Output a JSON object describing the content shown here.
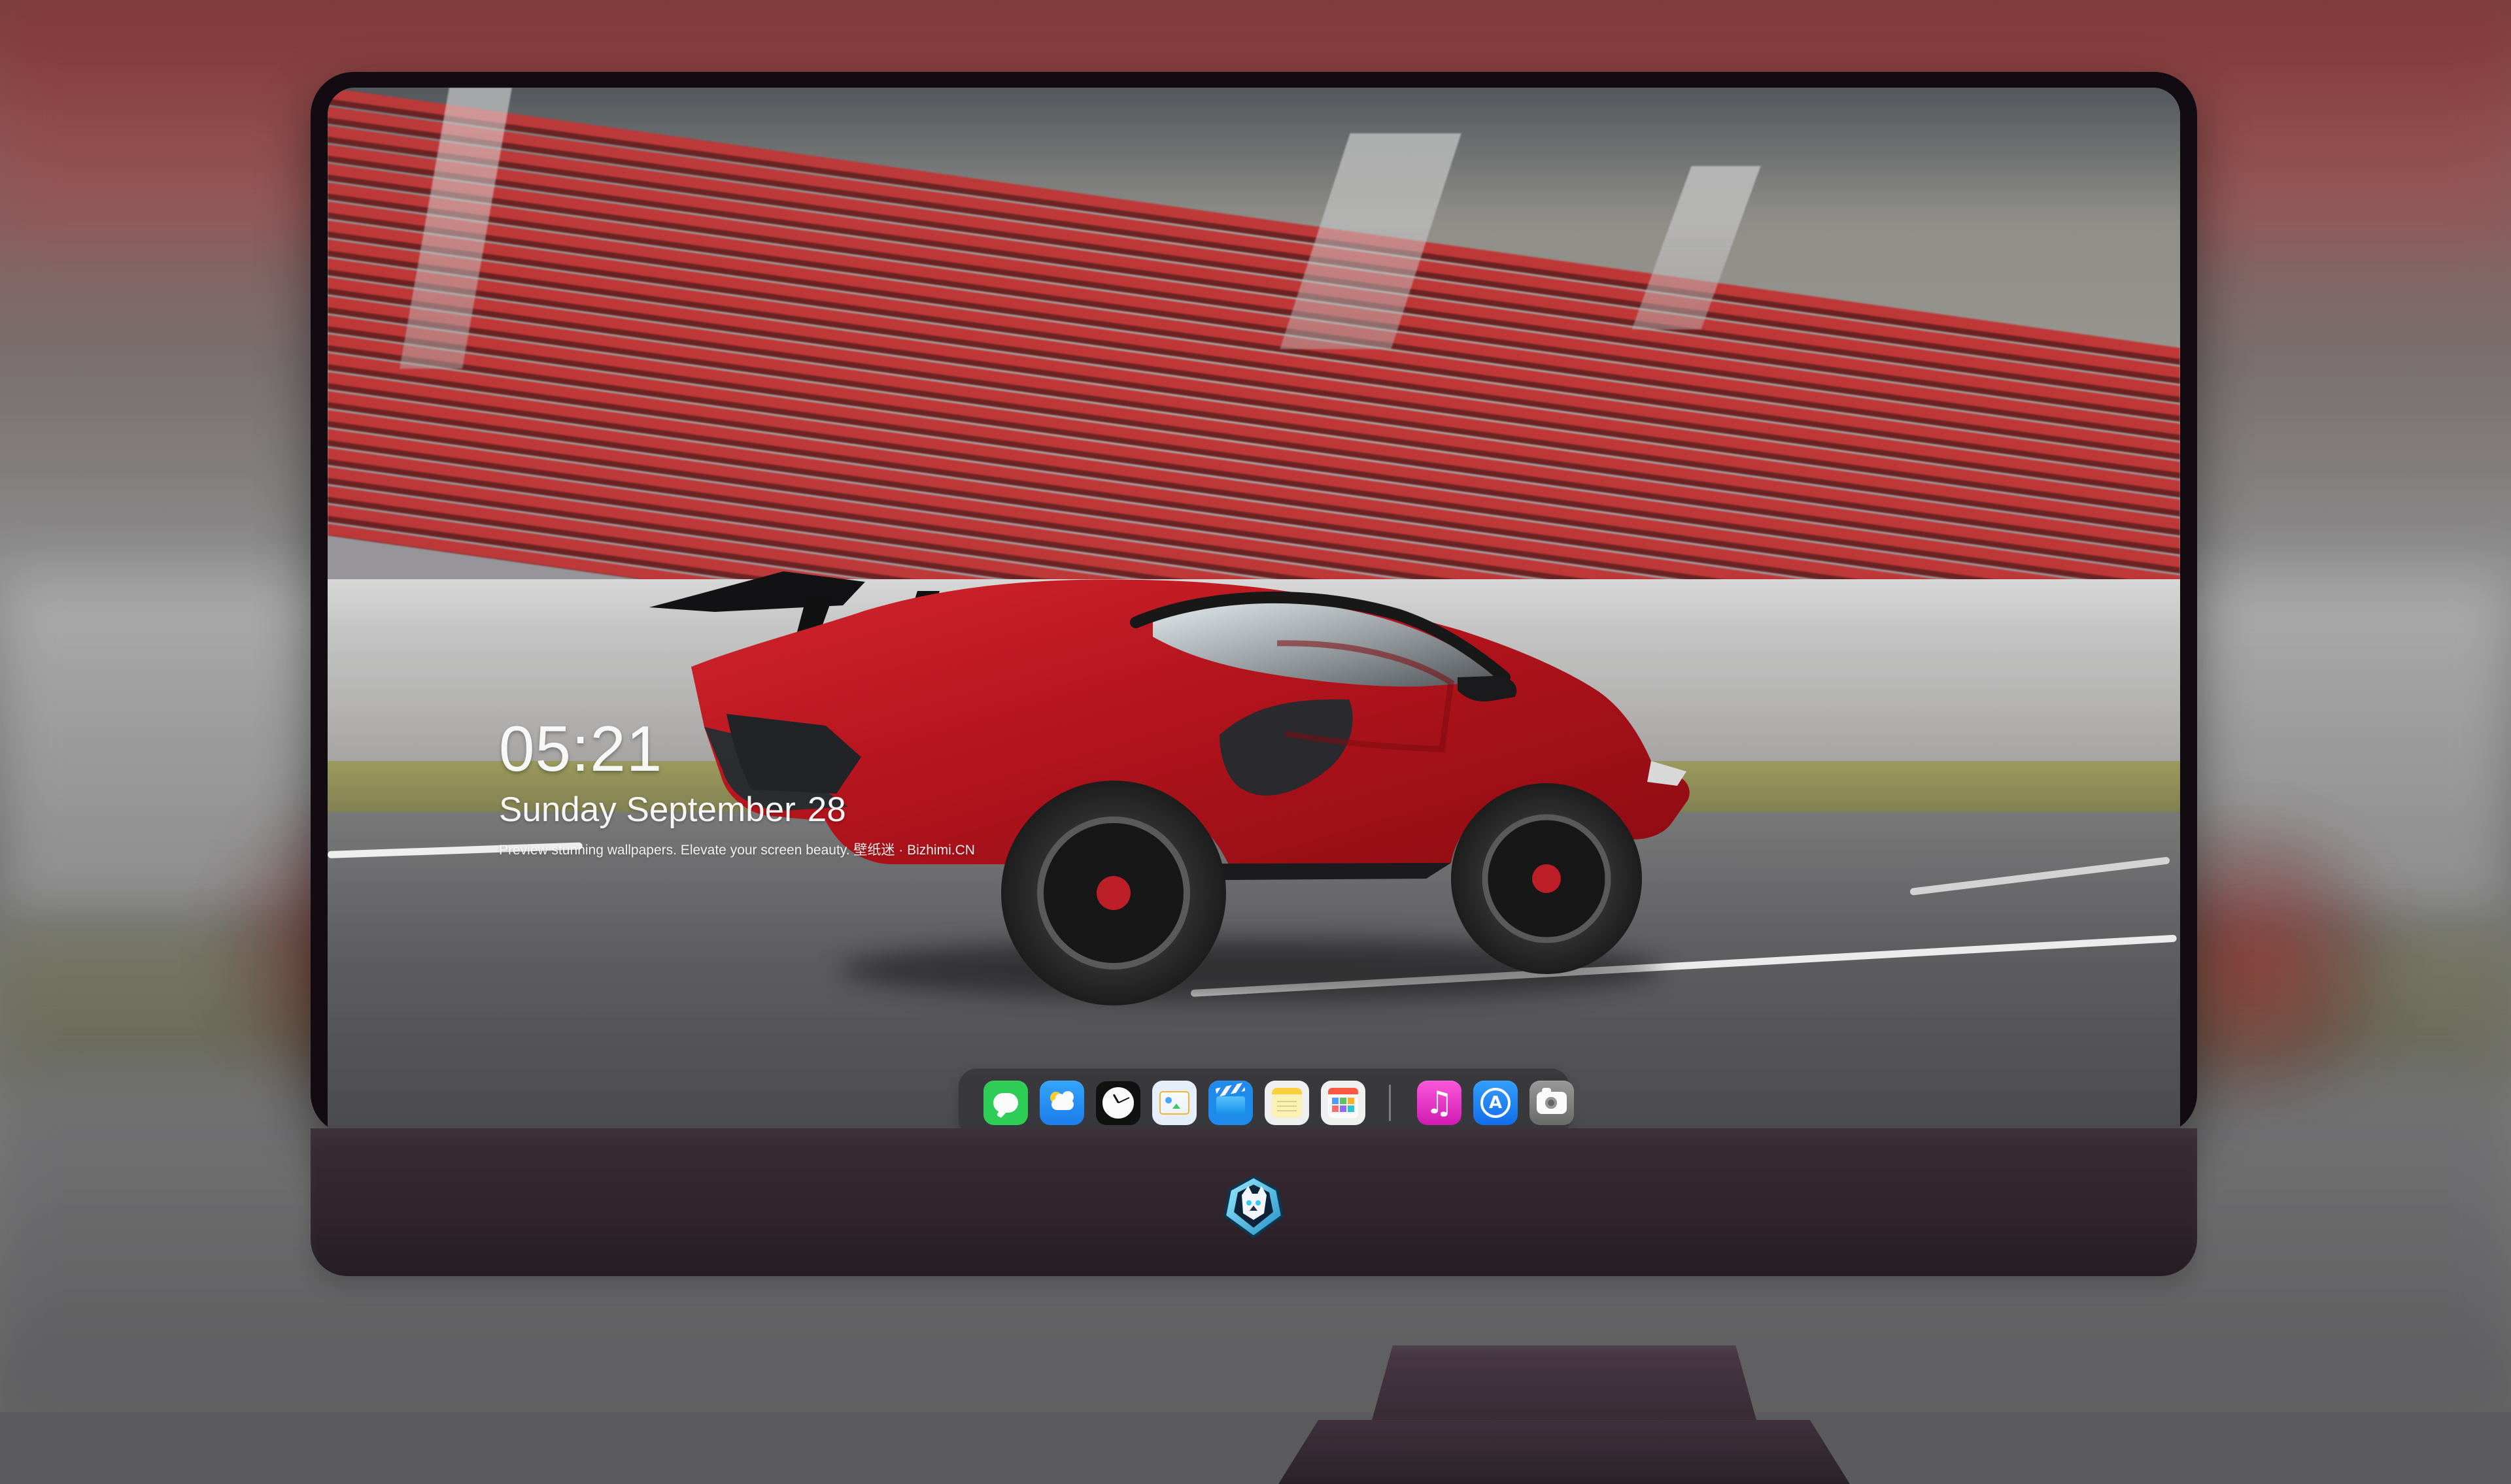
{
  "lock_screen": {
    "time": "05:21",
    "date_weekday_month": "Sunday September",
    "date_day": "28",
    "subtitle": "Preview stunning wallpapers. Elevate your screen beauty. 壁纸迷 · Bizhimi.CN"
  },
  "dock": {
    "left_icons": [
      {
        "name": "messages-icon"
      },
      {
        "name": "weather-icon"
      },
      {
        "name": "clock-icon"
      },
      {
        "name": "preview-icon"
      },
      {
        "name": "claquette-icon"
      },
      {
        "name": "notes-icon"
      },
      {
        "name": "calendar-grid-icon"
      }
    ],
    "right_icons": [
      {
        "name": "music-icon"
      },
      {
        "name": "app-store-icon"
      },
      {
        "name": "camera-icon"
      }
    ]
  },
  "colors": {
    "messages": "#2fd158",
    "weather": "#2b8cff",
    "music": "#ff3fd2",
    "appstore": "#1d8bff",
    "camera": "#8c8c8c",
    "bezel": "#120c12",
    "chin": "#31252d"
  },
  "brand": {
    "logo_icon": "wolf-badge-icon"
  }
}
